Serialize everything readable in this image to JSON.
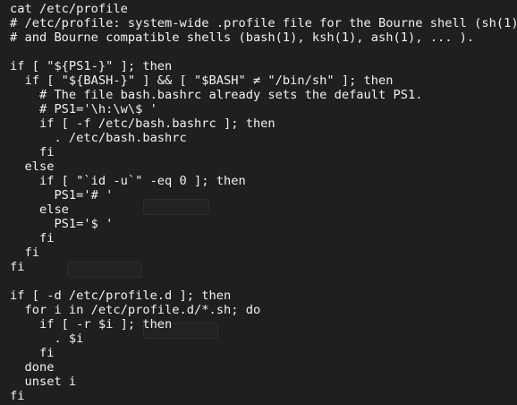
{
  "terminal": {
    "background_color": "#1f1f1f",
    "text_color": "#f2f2f2",
    "lines": [
      "cat /etc/profile",
      "# /etc/profile: system-wide .profile file for the Bourne shell (sh(1))",
      "# and Bourne compatible shells (bash(1), ksh(1), ash(1), ... ).",
      "",
      "if [ \"${PS1-}\" ]; then",
      "  if [ \"${BASH-}\" ] && [ \"$BASH\" ≠ \"/bin/sh\" ]; then",
      "    # The file bash.bashrc already sets the default PS1.",
      "    # PS1='\\h:\\w\\$ '",
      "    if [ -f /etc/bash.bashrc ]; then",
      "      . /etc/bash.bashrc",
      "    fi",
      "  else",
      "    if [ \"`id -u`\" -eq 0 ]; then",
      "      PS1='# '",
      "    else",
      "      PS1='$ '",
      "    fi",
      "  fi",
      "fi",
      "",
      "if [ -d /etc/profile.d ]; then",
      "  for i in /etc/profile.d/*.sh; do",
      "    if [ -r $i ]; then",
      "      . $i",
      "    fi",
      "  done",
      "  unset i",
      "fi"
    ]
  }
}
